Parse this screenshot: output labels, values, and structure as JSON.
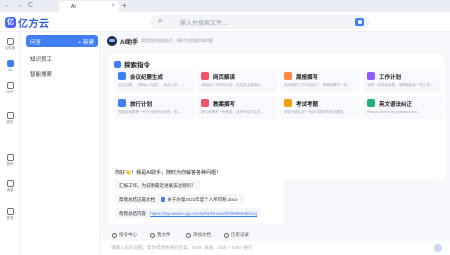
{
  "browser": {
    "back": "←",
    "forward": "→",
    "reload": "C",
    "tab_title": "AI",
    "tab_close": "×",
    "new_tab": "+"
  },
  "header": {
    "logo_mark": "亿",
    "logo_text": "亿方云",
    "search_placeholder": "输入并搜索文件..."
  },
  "rail": [
    {
      "label": "文件柜",
      "active": false
    },
    {
      "label": "AI",
      "active": true
    },
    {
      "label": "OCP",
      "active": false
    },
    {
      "label": "收件",
      "active": false
    },
    {
      "label": "协作",
      "active": false
    },
    {
      "label": "消息",
      "active": false
    },
    {
      "label": "任务",
      "active": false
    }
  ],
  "sidebar": {
    "items": [
      {
        "label": "问答",
        "action": "+ 新建"
      },
      {
        "label": "知识员工"
      },
      {
        "label": "智能搜索"
      }
    ]
  },
  "assistant": {
    "name": "AI助手",
    "subtitle": "我是您的智能助手，随时为您服务和问题"
  },
  "explore": {
    "title": "探索指令",
    "cards": [
      {
        "title": "会议纪要生成",
        "desc": "会议主题：【请输入内容】，参会人员：...",
        "color": "#3f7ef3"
      },
      {
        "title": "网页解读",
        "desc": "请阅读以下网页内容，总结其主要观点...",
        "color": "#f0566b"
      },
      {
        "title": "周报撰写",
        "desc": "我本周的工作内容如下，请帮我撰写一份...",
        "color": "#ff8a3d"
      },
      {
        "title": "工作计划",
        "desc": "我是一名项目经理，请帮我制定一份工作...",
        "color": "#8b5cf6"
      },
      {
        "title": "旅行计划",
        "desc": "你能给我推荐一份七日旅行计划吗，带...",
        "color": "#3f7ef3"
      },
      {
        "title": "教案撰写",
        "desc": "请为我撰写一份教案，适用于初中生的...",
        "color": "#f0566b"
      },
      {
        "title": "考试考题",
        "desc": "请你为我生成一份初中数学的考试题目...",
        "color": "#f59e0b"
      },
      {
        "title": "英文语法纠正",
        "desc": "Please correct my grammar and...",
        "color": "#22b07d"
      }
    ]
  },
  "chat": {
    "greeting": "你好👋！我是AI助手，随时为你解答各种问题！",
    "suggestion": "汇报工作，为说明最近进展该过程吗？",
    "doc_prompt": "帮我总结这篇文档",
    "doc_name": "关于办理2023年度个人所得税.docx",
    "link_prompt": "帮我总结内容",
    "link_url": "https://mp.weixin.qq.com/s/DUHnUsehf1fN8K845fcoq"
  },
  "toolbar": {
    "items": [
      "指令中心",
      "我文件",
      "添加文档",
      "历史记录"
    ]
  },
  "input": {
    "placeholder": "请输入您的问题，帮你得到你要的答案，Enter 发送，Shift + Enter 换行"
  }
}
